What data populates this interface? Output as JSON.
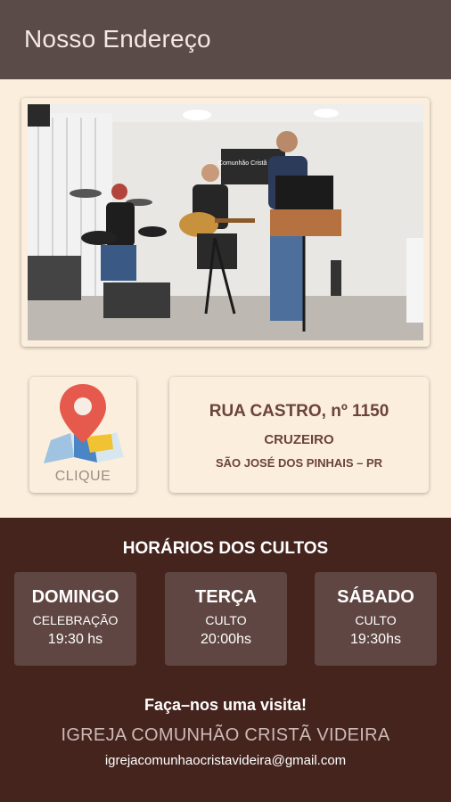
{
  "appbar": {
    "title": "Nosso Endereço"
  },
  "photo": {
    "banner_text": "Comunhão Cristã Videira"
  },
  "map": {
    "icon": "map-pin-icon",
    "label": "CLIQUE"
  },
  "address": {
    "street": "RUA CASTRO, nº 1150",
    "district": "CRUZEIRO",
    "city": "SÃO JOSÉ DOS PINHAIS – PR"
  },
  "schedule": {
    "title": "HORÁRIOS DOS CULTOS",
    "days": [
      {
        "day": "DOMINGO",
        "kind": "CELEBRAÇÃO",
        "time": "19:30 hs"
      },
      {
        "day": "TERÇA",
        "kind": "CULTO",
        "time": "20:00hs"
      },
      {
        "day": "SÁBADO",
        "kind": "CULTO",
        "time": "19:30hs"
      }
    ]
  },
  "footer": {
    "visit": "Faça–nos uma visita!",
    "church": "IGREJA COMUNHÃO CRISTÃ VIDEIRA",
    "email": "igrejacomunhaocristavideira@gmail.com"
  },
  "colors": {
    "appbar": "#5a4a48",
    "background": "#fbeedd",
    "schedule_bg": "#45241e",
    "day_card": "#5f4642",
    "address_text": "#6b4338"
  }
}
